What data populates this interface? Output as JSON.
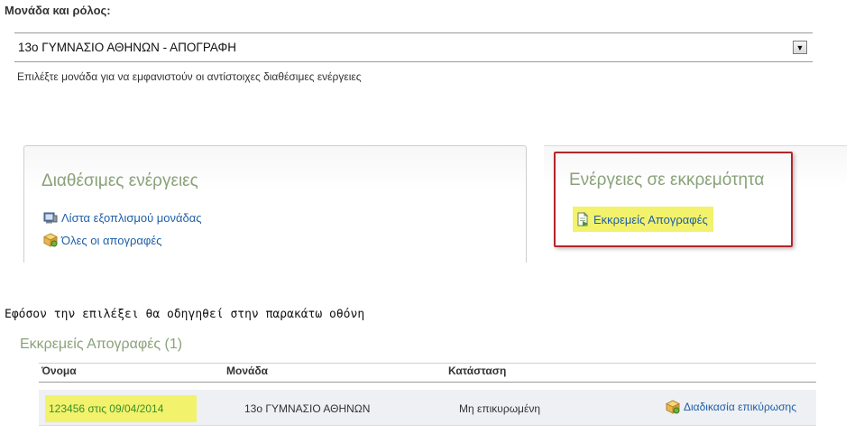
{
  "unit_role": {
    "label": "Μονάδα και ρόλος:",
    "selected_value": "13ο ΓΥΜΝΑΣΙΟ ΑΘΗΝΩΝ - ΑΠΟΓΡΑΦΗ",
    "hint": "Επιλέξτε μονάδα για να εμφανιστούν οι αντίστοιχες διαθέσιμες ενέργειες"
  },
  "available_actions": {
    "title": "Διαθέσιμες ενέργειες",
    "items": [
      {
        "label": "Λίστα εξοπλισμού μονάδας",
        "icon": "equipment-list-icon"
      },
      {
        "label": "Όλες οι απογραφές",
        "icon": "package-icon"
      }
    ]
  },
  "pending_actions": {
    "title": "Ενέργειες σε εκκρεμότητα",
    "items": [
      {
        "label": "Εκκρεμείς Απογραφές",
        "icon": "document-icon"
      }
    ]
  },
  "caption": "Εφόσον την επιλέξει θα οδηγηθεί στην παρακάτω οθόνη",
  "pending_inventories": {
    "title": "Εκκρεμείς Απογραφές (1)",
    "columns": [
      "Όνομα",
      "Μονάδα",
      "Κατάσταση"
    ],
    "rows": [
      {
        "name": "123456 στις 09/04/2014",
        "unit": "13ο ΓΥΜΝΑΣΙΟ ΑΘΗΝΩΝ",
        "status": "Μη επικυρωμένη",
        "action": "Διαδικασία επικύρωσης"
      }
    ]
  },
  "colors": {
    "accent_green": "#8aa27a",
    "link_blue": "#1f5fa8",
    "highlight_yellow": "#f2f26c",
    "annotation_red": "#b3262a"
  }
}
